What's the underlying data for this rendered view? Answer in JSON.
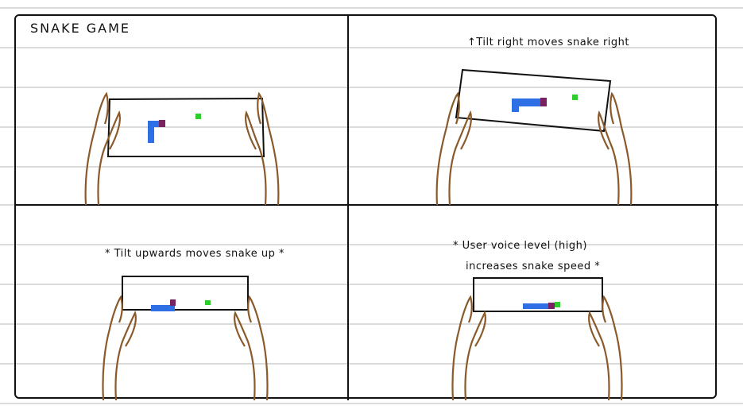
{
  "storyboard": {
    "title": "SNAKE GAME",
    "panels": [
      {
        "caption": ""
      },
      {
        "caption": "↑Tilt right moves snake right"
      },
      {
        "caption": "* Tilt upwards moves snake up *"
      },
      {
        "caption_line1": "* User voice level (high)",
        "caption_line2": "increases snake speed *"
      }
    ]
  },
  "colors": {
    "snake_body": "#2f6fe6",
    "snake_head": "#7a2160",
    "food": "#2ecc2e",
    "hands": "#8a5a2b",
    "ink": "#111111",
    "ruled_line": "#cfcfcf"
  }
}
